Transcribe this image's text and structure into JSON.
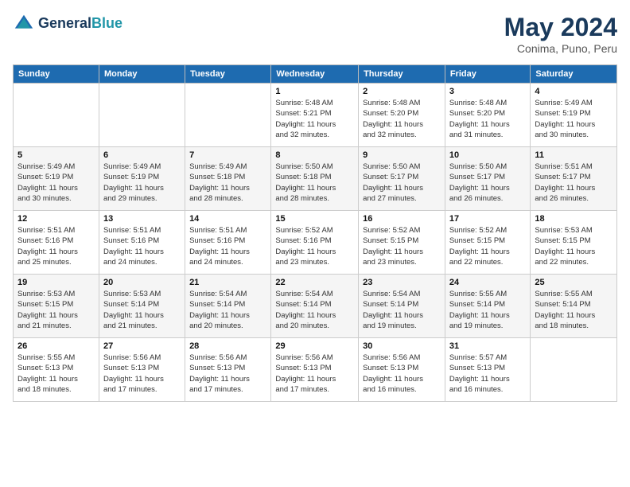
{
  "header": {
    "logo": {
      "line1": "General",
      "line2": "Blue"
    },
    "title": "May 2024",
    "location": "Conima, Puno, Peru"
  },
  "weekdays": [
    "Sunday",
    "Monday",
    "Tuesday",
    "Wednesday",
    "Thursday",
    "Friday",
    "Saturday"
  ],
  "weeks": [
    [
      {
        "day": "",
        "info": ""
      },
      {
        "day": "",
        "info": ""
      },
      {
        "day": "",
        "info": ""
      },
      {
        "day": "1",
        "info": "Sunrise: 5:48 AM\nSunset: 5:21 PM\nDaylight: 11 hours\nand 32 minutes."
      },
      {
        "day": "2",
        "info": "Sunrise: 5:48 AM\nSunset: 5:20 PM\nDaylight: 11 hours\nand 32 minutes."
      },
      {
        "day": "3",
        "info": "Sunrise: 5:48 AM\nSunset: 5:20 PM\nDaylight: 11 hours\nand 31 minutes."
      },
      {
        "day": "4",
        "info": "Sunrise: 5:49 AM\nSunset: 5:19 PM\nDaylight: 11 hours\nand 30 minutes."
      }
    ],
    [
      {
        "day": "5",
        "info": "Sunrise: 5:49 AM\nSunset: 5:19 PM\nDaylight: 11 hours\nand 30 minutes."
      },
      {
        "day": "6",
        "info": "Sunrise: 5:49 AM\nSunset: 5:19 PM\nDaylight: 11 hours\nand 29 minutes."
      },
      {
        "day": "7",
        "info": "Sunrise: 5:49 AM\nSunset: 5:18 PM\nDaylight: 11 hours\nand 28 minutes."
      },
      {
        "day": "8",
        "info": "Sunrise: 5:50 AM\nSunset: 5:18 PM\nDaylight: 11 hours\nand 28 minutes."
      },
      {
        "day": "9",
        "info": "Sunrise: 5:50 AM\nSunset: 5:17 PM\nDaylight: 11 hours\nand 27 minutes."
      },
      {
        "day": "10",
        "info": "Sunrise: 5:50 AM\nSunset: 5:17 PM\nDaylight: 11 hours\nand 26 minutes."
      },
      {
        "day": "11",
        "info": "Sunrise: 5:51 AM\nSunset: 5:17 PM\nDaylight: 11 hours\nand 26 minutes."
      }
    ],
    [
      {
        "day": "12",
        "info": "Sunrise: 5:51 AM\nSunset: 5:16 PM\nDaylight: 11 hours\nand 25 minutes."
      },
      {
        "day": "13",
        "info": "Sunrise: 5:51 AM\nSunset: 5:16 PM\nDaylight: 11 hours\nand 24 minutes."
      },
      {
        "day": "14",
        "info": "Sunrise: 5:51 AM\nSunset: 5:16 PM\nDaylight: 11 hours\nand 24 minutes."
      },
      {
        "day": "15",
        "info": "Sunrise: 5:52 AM\nSunset: 5:16 PM\nDaylight: 11 hours\nand 23 minutes."
      },
      {
        "day": "16",
        "info": "Sunrise: 5:52 AM\nSunset: 5:15 PM\nDaylight: 11 hours\nand 23 minutes."
      },
      {
        "day": "17",
        "info": "Sunrise: 5:52 AM\nSunset: 5:15 PM\nDaylight: 11 hours\nand 22 minutes."
      },
      {
        "day": "18",
        "info": "Sunrise: 5:53 AM\nSunset: 5:15 PM\nDaylight: 11 hours\nand 22 minutes."
      }
    ],
    [
      {
        "day": "19",
        "info": "Sunrise: 5:53 AM\nSunset: 5:15 PM\nDaylight: 11 hours\nand 21 minutes."
      },
      {
        "day": "20",
        "info": "Sunrise: 5:53 AM\nSunset: 5:14 PM\nDaylight: 11 hours\nand 21 minutes."
      },
      {
        "day": "21",
        "info": "Sunrise: 5:54 AM\nSunset: 5:14 PM\nDaylight: 11 hours\nand 20 minutes."
      },
      {
        "day": "22",
        "info": "Sunrise: 5:54 AM\nSunset: 5:14 PM\nDaylight: 11 hours\nand 20 minutes."
      },
      {
        "day": "23",
        "info": "Sunrise: 5:54 AM\nSunset: 5:14 PM\nDaylight: 11 hours\nand 19 minutes."
      },
      {
        "day": "24",
        "info": "Sunrise: 5:55 AM\nSunset: 5:14 PM\nDaylight: 11 hours\nand 19 minutes."
      },
      {
        "day": "25",
        "info": "Sunrise: 5:55 AM\nSunset: 5:14 PM\nDaylight: 11 hours\nand 18 minutes."
      }
    ],
    [
      {
        "day": "26",
        "info": "Sunrise: 5:55 AM\nSunset: 5:13 PM\nDaylight: 11 hours\nand 18 minutes."
      },
      {
        "day": "27",
        "info": "Sunrise: 5:56 AM\nSunset: 5:13 PM\nDaylight: 11 hours\nand 17 minutes."
      },
      {
        "day": "28",
        "info": "Sunrise: 5:56 AM\nSunset: 5:13 PM\nDaylight: 11 hours\nand 17 minutes."
      },
      {
        "day": "29",
        "info": "Sunrise: 5:56 AM\nSunset: 5:13 PM\nDaylight: 11 hours\nand 17 minutes."
      },
      {
        "day": "30",
        "info": "Sunrise: 5:56 AM\nSunset: 5:13 PM\nDaylight: 11 hours\nand 16 minutes."
      },
      {
        "day": "31",
        "info": "Sunrise: 5:57 AM\nSunset: 5:13 PM\nDaylight: 11 hours\nand 16 minutes."
      },
      {
        "day": "",
        "info": ""
      }
    ]
  ]
}
